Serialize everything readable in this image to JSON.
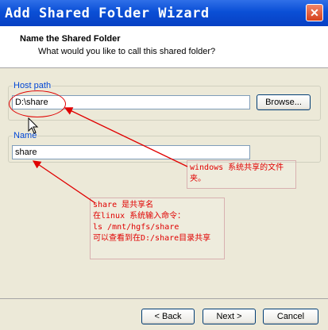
{
  "window": {
    "title": "Add Shared Folder Wizard",
    "close_glyph": "✕"
  },
  "header": {
    "title": "Name the Shared Folder",
    "subtitle": "What would you like to call this shared folder?"
  },
  "host_path": {
    "label": "Host path",
    "value": "D:\\share",
    "browse_label": "Browse..."
  },
  "name": {
    "label": "Name",
    "value": "share"
  },
  "buttons": {
    "back": "< Back",
    "next": "Next >",
    "cancel": "Cancel"
  },
  "annotations": {
    "windows_note": [
      "windows 系统共享的文件",
      "夹。"
    ],
    "linux_note": [
      "share 是共享名",
      "在linux 系统输入命令：",
      "ls  /mnt/hgfs/share",
      "可以查看到在D:/share目录共享"
    ]
  },
  "colors": {
    "accent": "#0046d5",
    "annotation": "#e00000",
    "titlebar": "#0a4fd6"
  },
  "icons": [
    "close-icon",
    "mouse-cursor-icon"
  ]
}
